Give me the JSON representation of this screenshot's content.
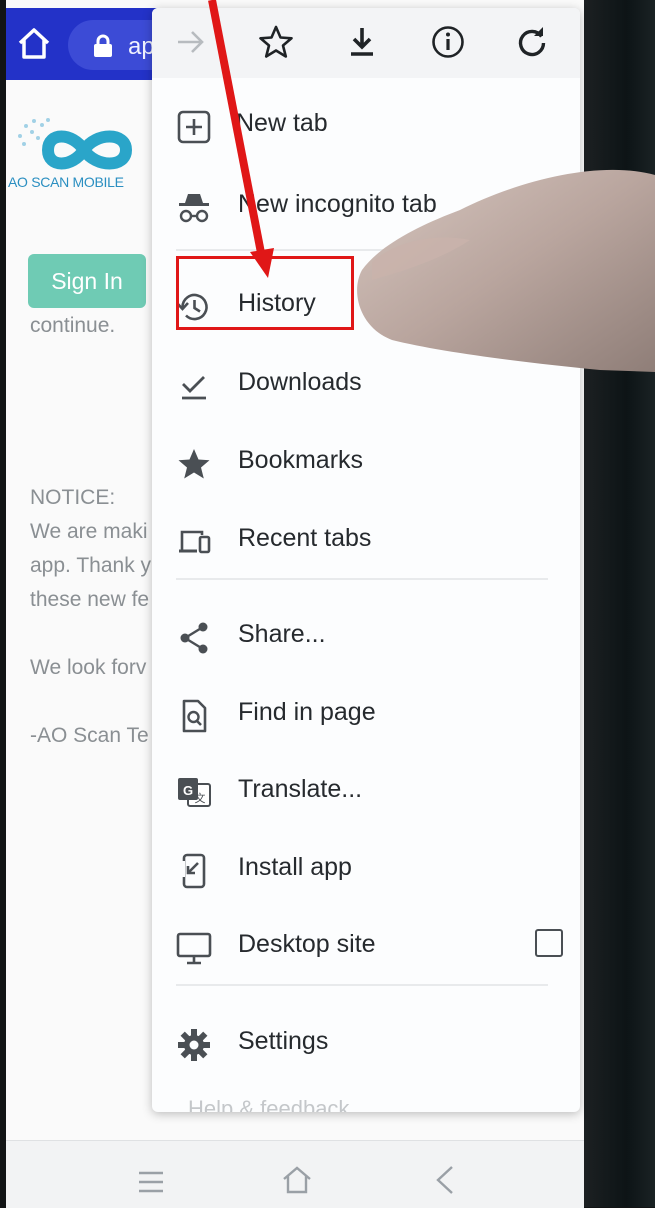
{
  "browser": {
    "url_text": "ap",
    "toolbar_icons": [
      "forward-icon",
      "star-icon",
      "download-icon",
      "info-icon",
      "reload-icon"
    ]
  },
  "page": {
    "logo_text": "AO SCAN MOBILE",
    "sign_in_label": "Sign In",
    "continue_text": "continue.",
    "notice_lines": [
      "NOTICE:",
      "We are maki",
      "app. Thank y",
      "these new fe",
      "We look forv",
      "-AO Scan Te"
    ]
  },
  "menu": {
    "items": [
      {
        "label": "New tab",
        "icon": "new-tab-icon"
      },
      {
        "label": "New incognito tab",
        "icon": "incognito-icon"
      },
      {
        "label": "History",
        "icon": "history-icon"
      },
      {
        "label": "Downloads",
        "icon": "downloads-icon"
      },
      {
        "label": "Bookmarks",
        "icon": "bookmarks-star-icon"
      },
      {
        "label": "Recent tabs",
        "icon": "recent-tabs-icon"
      },
      {
        "label": "Share...",
        "icon": "share-icon"
      },
      {
        "label": "Find in page",
        "icon": "find-in-page-icon"
      },
      {
        "label": "Translate...",
        "icon": "translate-icon"
      },
      {
        "label": "Install app",
        "icon": "install-app-icon"
      },
      {
        "label": "Desktop site",
        "icon": "desktop-icon",
        "checked": false
      },
      {
        "label": "Settings",
        "icon": "settings-gear-icon"
      },
      {
        "label": "Help & feedback",
        "icon": "help-icon"
      }
    ]
  },
  "annotation": {
    "highlight_color": "#e01717"
  },
  "colors": {
    "toolbar": "#2332c8",
    "accent_button": "#6fcbb4"
  }
}
